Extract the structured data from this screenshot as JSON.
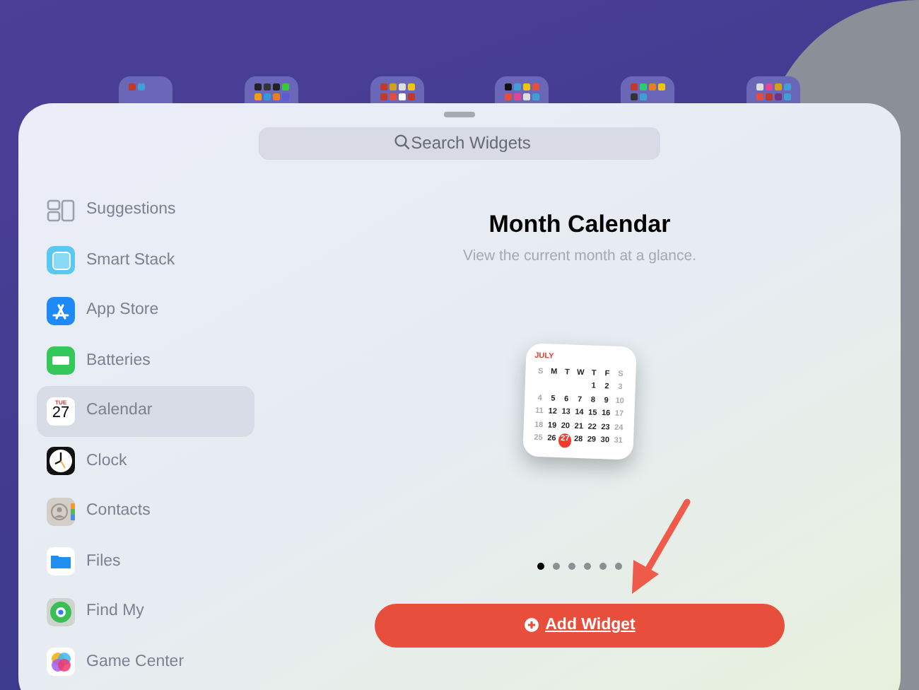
{
  "search": {
    "placeholder": "Search Widgets"
  },
  "sidebar": {
    "items": [
      {
        "label": "Suggestions",
        "kind": "suggestions",
        "selected": false
      },
      {
        "label": "Smart Stack",
        "kind": "stack",
        "selected": false
      },
      {
        "label": "App Store",
        "kind": "appstore",
        "selected": false
      },
      {
        "label": "Batteries",
        "kind": "battery",
        "selected": false
      },
      {
        "label": "Calendar",
        "kind": "calendar",
        "selected": true,
        "icon_day": "TUE",
        "icon_date": "27"
      },
      {
        "label": "Clock",
        "kind": "clock",
        "selected": false
      },
      {
        "label": "Contacts",
        "kind": "contacts",
        "selected": false
      },
      {
        "label": "Files",
        "kind": "files",
        "selected": false
      },
      {
        "label": "Find My",
        "kind": "findmy",
        "selected": false
      },
      {
        "label": "Game Center",
        "kind": "gamecenter",
        "selected": false
      }
    ]
  },
  "widget": {
    "title": "Month Calendar",
    "subtitle": "View the current month at a glance.",
    "month": "JULY",
    "weekdays": [
      "S",
      "M",
      "T",
      "W",
      "T",
      "F",
      "S"
    ],
    "weeks": [
      [
        {
          "d": "1",
          "selected": false
        },
        {
          "d": "2",
          "selected": false
        },
        {
          "d": "3",
          "selected": false
        }
      ],
      [
        {
          "d": "4",
          "selected": false
        },
        {
          "d": "5",
          "selected": false
        },
        {
          "d": "6",
          "selected": false
        },
        {
          "d": "7",
          "selected": false
        },
        {
          "d": "8",
          "selected": false
        },
        {
          "d": "9",
          "selected": false
        },
        {
          "d": "10",
          "selected": false
        }
      ],
      [
        {
          "d": "11",
          "selected": false
        },
        {
          "d": "12",
          "selected": false
        },
        {
          "d": "13",
          "selected": false
        },
        {
          "d": "14",
          "selected": false
        },
        {
          "d": "15",
          "selected": false
        },
        {
          "d": "16",
          "selected": false
        },
        {
          "d": "17",
          "selected": false
        }
      ],
      [
        {
          "d": "18",
          "selected": false
        },
        {
          "d": "19",
          "selected": false
        },
        {
          "d": "20",
          "selected": false
        },
        {
          "d": "21",
          "selected": false
        },
        {
          "d": "22",
          "selected": false
        },
        {
          "d": "23",
          "selected": false
        },
        {
          "d": "24",
          "selected": false
        }
      ],
      [
        {
          "d": "25",
          "selected": false
        },
        {
          "d": "26",
          "selected": false
        },
        {
          "d": "27",
          "selected": true
        },
        {
          "d": "28",
          "selected": false
        },
        {
          "d": "29",
          "selected": false
        },
        {
          "d": "30",
          "selected": false
        },
        {
          "d": "31",
          "selected": false
        }
      ]
    ],
    "pages": [
      {
        "selected": true
      },
      {
        "selected": false
      },
      {
        "selected": false
      },
      {
        "selected": false
      },
      {
        "selected": false
      },
      {
        "selected": false
      }
    ]
  },
  "add_button": {
    "label": "Add Widget"
  }
}
